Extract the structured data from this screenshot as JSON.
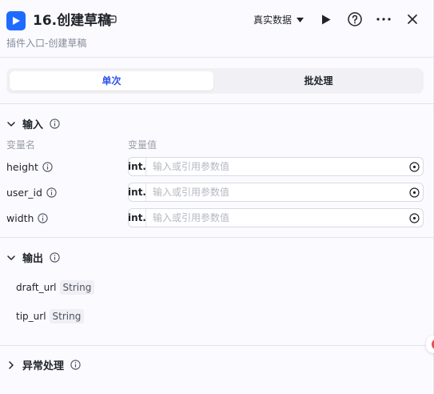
{
  "header": {
    "title": "16.创建草稿",
    "subtitle": "插件入口-创建草稿",
    "data_mode": "真实数据",
    "icons": [
      "edit-icon",
      "play-icon",
      "help-icon",
      "more-icon",
      "close-icon"
    ]
  },
  "tabs": [
    {
      "label": "单次",
      "active": true
    },
    {
      "label": "批处理",
      "active": false
    }
  ],
  "input_section": {
    "title": "输入",
    "col_name": "变量名",
    "col_value": "变量值",
    "rows": [
      {
        "name": "height",
        "type": "int.",
        "placeholder": "输入或引用参数值"
      },
      {
        "name": "user_id",
        "type": "int.",
        "placeholder": "输入或引用参数值"
      },
      {
        "name": "width",
        "type": "int.",
        "placeholder": "输入或引用参数值"
      }
    ]
  },
  "output_section": {
    "title": "输出",
    "rows": [
      {
        "name": "draft_url",
        "type": "String"
      },
      {
        "name": "tip_url",
        "type": "String"
      }
    ]
  },
  "exception_section": {
    "title": "异常处理"
  },
  "colors": {
    "accent": "#2f54eb",
    "app_icon": "#1f6bff",
    "background": "#fbfaff"
  }
}
